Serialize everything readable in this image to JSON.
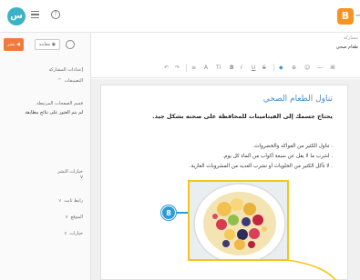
{
  "topbar": {
    "avatar_letter": "س",
    "logo_letter": "B",
    "back_arrow": "→"
  },
  "sidebar": {
    "publish_label": "نشر",
    "preview_label": "معاينة",
    "items": [
      {
        "label": "إعدادات المشاركة"
      },
      {
        "label": "التصنيفات"
      },
      {
        "label": "قسم الصفحات المرتبطة"
      },
      {
        "label": "لم يتم العثور على نتائج مطابقة"
      },
      {
        "label": "خيارات النشر"
      },
      {
        "label": "رابط ثابت"
      },
      {
        "label": "الموقع"
      },
      {
        "label": "خيارات"
      }
    ]
  },
  "right_strip": {
    "line1": "مشاركة",
    "line2": "طعام صحي"
  },
  "toolbar": {
    "items": [
      "↶",
      "↷",
      "≡",
      "A",
      "Ti",
      "B",
      "I",
      "U",
      "S",
      "◆",
      "⊕",
      "☺",
      "—",
      "⌘"
    ]
  },
  "post": {
    "title": "تناول الطعام الصحي",
    "subtitle": "يحتاج جسمك إلى الفيتامينات للمحافظة على صحته بشكل جيد.",
    "bullets": [
      ". تناول الكثير من الفواكه والخضروات.",
      ". اشرب ما لا يقل عن سبعة أكواب من الماء كل يوم.",
      ". لا تأكل الكثير من الحلويات أو تشرب العديد من المشروبات الغازية."
    ]
  },
  "callout": {
    "step_number": "8"
  },
  "colors": {
    "accent_orange": "#f07a3c",
    "logo_orange": "#f7931e",
    "avatar_teal": "#3bb3c6",
    "title_blue": "#4a8bc6",
    "step_blue": "#2e9ad8",
    "highlight_yellow": "#f6c51a"
  }
}
